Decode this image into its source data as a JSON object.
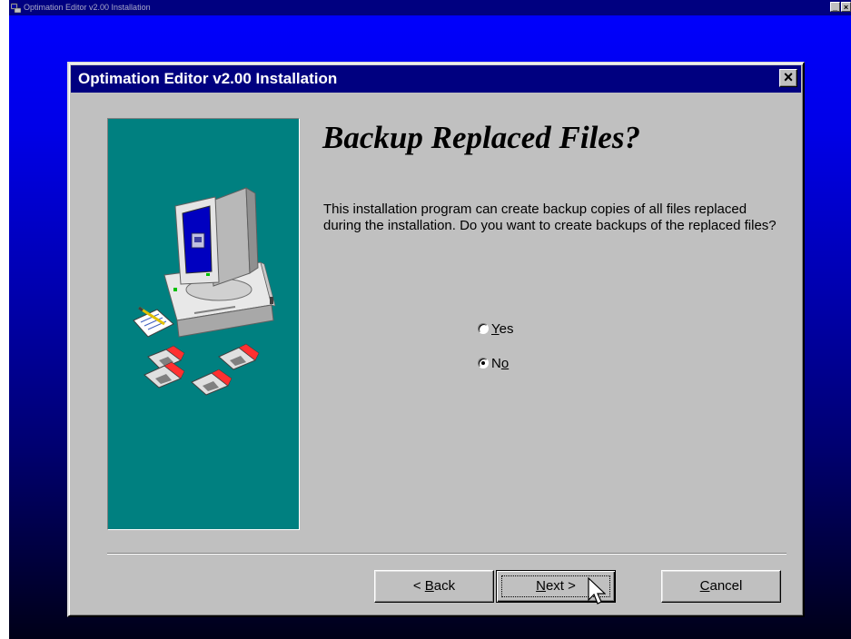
{
  "outer_window": {
    "title": "Optimation Editor v2.00 Installation",
    "controls": [
      "_",
      "×"
    ]
  },
  "dialog": {
    "title": "Optimation Editor v2.00 Installation",
    "close_label": "×",
    "heading": "Backup Replaced Files?",
    "body": "This installation program can create backup copies of all files replaced during the installation.  Do you want to create backups of the replaced files?",
    "options": [
      {
        "label_mnemonic": "Y",
        "label_rest": "es",
        "selected": false
      },
      {
        "label_pre": "N",
        "label_mnemonic": "o",
        "selected": true
      }
    ],
    "buttons": {
      "back": {
        "prefix": "< ",
        "mnemonic": "B",
        "rest": "ack"
      },
      "next": {
        "mnemonic": "N",
        "rest": "ext >"
      },
      "cancel": {
        "mnemonic": "C",
        "rest": "ancel"
      }
    }
  },
  "colors": {
    "desktop_top": "#0000ff",
    "desktop_bottom": "#000018",
    "titlebar": "#000080",
    "panel": "#008080",
    "face": "#c0c0c0"
  },
  "icons": [
    "computer-icon",
    "floppy-disk-icon",
    "notepad-pencil-icon",
    "close-icon",
    "mouse-cursor-icon"
  ]
}
